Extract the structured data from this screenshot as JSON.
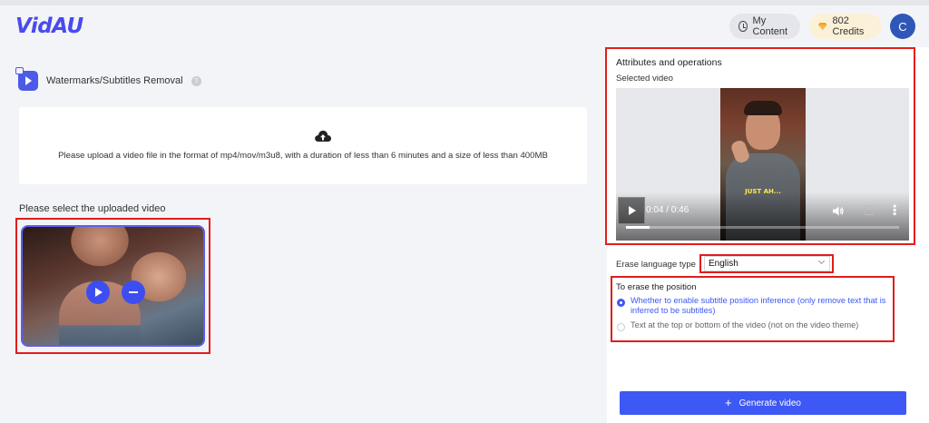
{
  "app": {
    "logo": "VidAU"
  },
  "header": {
    "my_content_label": "My Content",
    "credits_label": "802 Credits",
    "avatar_initial": "C"
  },
  "tool": {
    "title": "Watermarks/Subtitles Removal",
    "help_icon": "question-circle-icon",
    "icon": "video-tool-icon"
  },
  "upload": {
    "icon": "cloud-upload-icon",
    "message": "Please upload a video file in the format of mp4/mov/m3u8, with a duration of less than 6 minutes and a size of less than 400MB"
  },
  "uploaded": {
    "label": "Please select the uploaded video",
    "play_icon": "play-icon",
    "remove_icon": "minus-icon"
  },
  "attributes": {
    "title": "Attributes and operations",
    "selected_video_label": "Selected video",
    "video": {
      "caption": "JUST AH...",
      "current_time": "0:04",
      "duration": "0:46",
      "time_display": "0:04 / 0:46",
      "progress": 0.087
    }
  },
  "erase_language": {
    "label": "Erase language type",
    "value": "English"
  },
  "erase_position": {
    "title": "To erase the position",
    "options": [
      {
        "label": "Whether to enable subtitle position inference (only remove text that is inferred to be subtitles)",
        "selected": true
      },
      {
        "label": "Text at the top or bottom of the video (not on the video theme)",
        "selected": false
      }
    ]
  },
  "generate": {
    "label": "Generate video",
    "icon": "plus-icon"
  },
  "colors": {
    "accent": "#3d58f5",
    "highlight": "#e11d1d",
    "logo": "#4a4af0",
    "avatar": "#2f57b6"
  }
}
